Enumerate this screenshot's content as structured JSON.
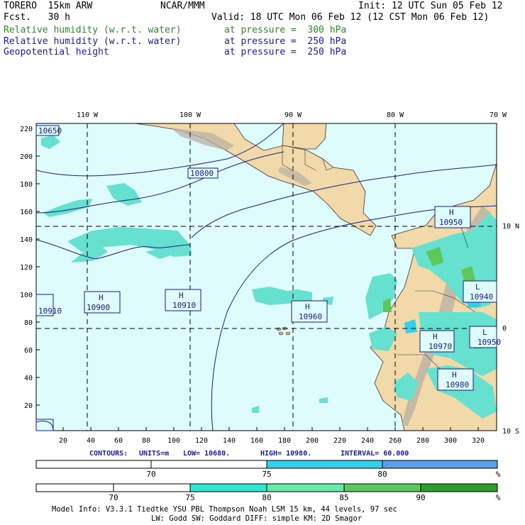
{
  "header": {
    "model": "TORERO  15km ARW",
    "center": "NCAR/MMM",
    "init": "Init: 12 UTC Sun 05 Feb 12",
    "fcst": "Fcst.   30 h",
    "valid": "Valid: 18 UTC Mon 06 Feb 12 (12 CST Mon 06 Feb 12)",
    "fields": [
      {
        "name": "Relative humidity (w.r.t. water)",
        "level": "at pressure =  300 hPa",
        "color": "#2e8b2e"
      },
      {
        "name": "Relative humidity (w.r.t. water)",
        "level": "at pressure =  250 hPa",
        "color": "#1a1ab4"
      },
      {
        "name": "Geopotential height",
        "level": "at pressure =  250 hPa",
        "color": "#1a1ab4"
      }
    ]
  },
  "map": {
    "colors": {
      "ocean": "#dffcfc",
      "land": "#f1d9a9",
      "contour": "#1a1a8c"
    },
    "top_lon_labels": [
      "110 W",
      "100 W",
      "90 W",
      "80 W",
      "70 W"
    ],
    "right_lat_labels": [
      "10 N",
      "0",
      "10 S"
    ],
    "y_ticks": [
      "220",
      "200",
      "180",
      "160",
      "140",
      "120",
      "100",
      "80",
      "60",
      "40",
      "20"
    ],
    "x_ticks": [
      "20",
      "40",
      "60",
      "80",
      "100",
      "120",
      "140",
      "160",
      "180",
      "200",
      "220",
      "240",
      "260",
      "280",
      "300",
      "320"
    ],
    "contour_labels": [
      "10650",
      "10800",
      "10950",
      "10910",
      "10960",
      "10970",
      "10940",
      "10950",
      "10980"
    ],
    "highs": [
      {
        "letter": "H",
        "value": "10910"
      },
      {
        "letter": "H",
        "value": "10900"
      },
      {
        "letter": "H",
        "value": "10910"
      },
      {
        "letter": "H",
        "value": "10960"
      },
      {
        "letter": "H",
        "value": "10970"
      },
      {
        "letter": "H",
        "value": "10980"
      },
      {
        "letter": "L",
        "value": "10940"
      },
      {
        "letter": "L",
        "value": "10950"
      }
    ]
  },
  "contours_info": {
    "prefix": "CONTOURS:",
    "units": "UNITS=m",
    "low": "LOW=  10680.",
    "high": "HIGH=  10980.",
    "interval": "INTERVAL=   60.000"
  },
  "colorbar1": {
    "unit": "%",
    "labels": [
      "70",
      "75",
      "80"
    ],
    "segments": [
      {
        "label_left": "",
        "color": "#ffffff"
      },
      {
        "label_left": "75",
        "color": "#36cfea"
      },
      {
        "label_left": "80",
        "color": "#5c9ee8"
      }
    ]
  },
  "colorbar2": {
    "unit": "%",
    "labels": [
      "70",
      "75",
      "80",
      "85",
      "90"
    ],
    "segments": [
      {
        "color": "#ffffff"
      },
      {
        "color": "#ffffff"
      },
      {
        "color": "#2ee8d0"
      },
      {
        "color": "#66eca6"
      },
      {
        "color": "#5cc85c"
      },
      {
        "color": "#2e9e2e"
      }
    ]
  },
  "footer": {
    "line1": "Model Info: V3.3.1   Tiedtke YSU PBL  Thompson    Noah LSM  15 km,   44 levels,   97 sec",
    "line2": "LW: Godd SW: Goddard DIFF: simple KM: 2D Smagor"
  }
}
